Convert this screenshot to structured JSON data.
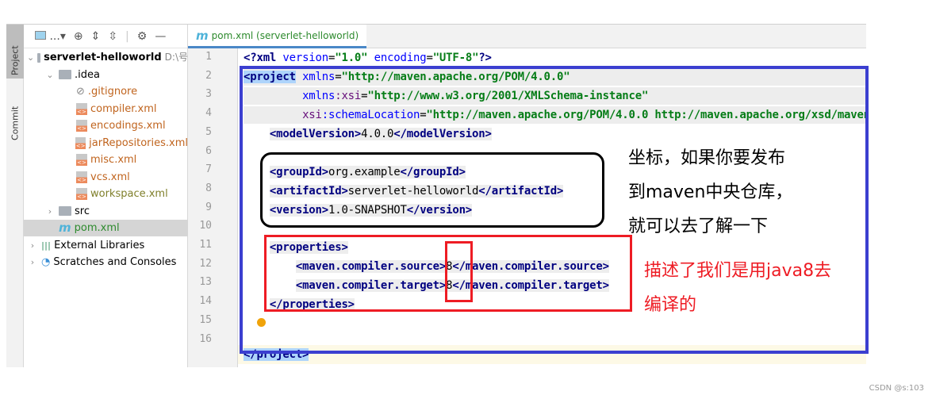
{
  "side_tabs": [
    "Project",
    "Commit"
  ],
  "project_panel": {
    "toolbar": [
      "...",
      "target-icon",
      "expand-icon",
      "collapse-icon",
      "gear-icon",
      "minimize-icon"
    ],
    "tree": [
      {
        "label": "serverlet-helloworld",
        "suffix": "D:\\号",
        "kind": "module",
        "depth": 0,
        "expanded": true
      },
      {
        "label": ".idea",
        "kind": "folder",
        "depth": 1,
        "expanded": true
      },
      {
        "label": ".gitignore",
        "kind": "ignored",
        "depth": 2
      },
      {
        "label": "compiler.xml",
        "kind": "xml",
        "depth": 2
      },
      {
        "label": "encodings.xml",
        "kind": "xml",
        "depth": 2
      },
      {
        "label": "jarRepositories.xml",
        "kind": "xml",
        "depth": 2
      },
      {
        "label": "misc.xml",
        "kind": "xml",
        "depth": 2
      },
      {
        "label": "vcs.xml",
        "kind": "xml",
        "depth": 2
      },
      {
        "label": "workspace.xml",
        "kind": "xml-mod",
        "depth": 2
      },
      {
        "label": "src",
        "kind": "folder",
        "depth": 1,
        "expanded": false
      },
      {
        "label": "pom.xml",
        "kind": "maven",
        "depth": 1,
        "selected": true
      },
      {
        "label": "External Libraries",
        "kind": "libs",
        "depth": 0,
        "expanded": false
      },
      {
        "label": "Scratches and Consoles",
        "kind": "scratch",
        "depth": 0,
        "expanded": false
      }
    ]
  },
  "editor": {
    "tab": "pom.xml (serverlet-helloworld)",
    "line_numbers": [
      "1",
      "2",
      "3",
      "4",
      "5",
      "6",
      "7",
      "8",
      "9",
      "10",
      "11",
      "12",
      "13",
      "14",
      "15",
      "16"
    ]
  },
  "annotations": {
    "coord_note": [
      "坐标，如果你要发布",
      "到maven中央仓库，",
      "就可以去了解一下"
    ],
    "java_note": [
      "描述了我们是用java8去",
      "编译的"
    ],
    "colors": {
      "blue": "#3b3fd0",
      "black": "#000000",
      "red": "#ee1c24"
    }
  },
  "watermark": "CSDN @s:103"
}
